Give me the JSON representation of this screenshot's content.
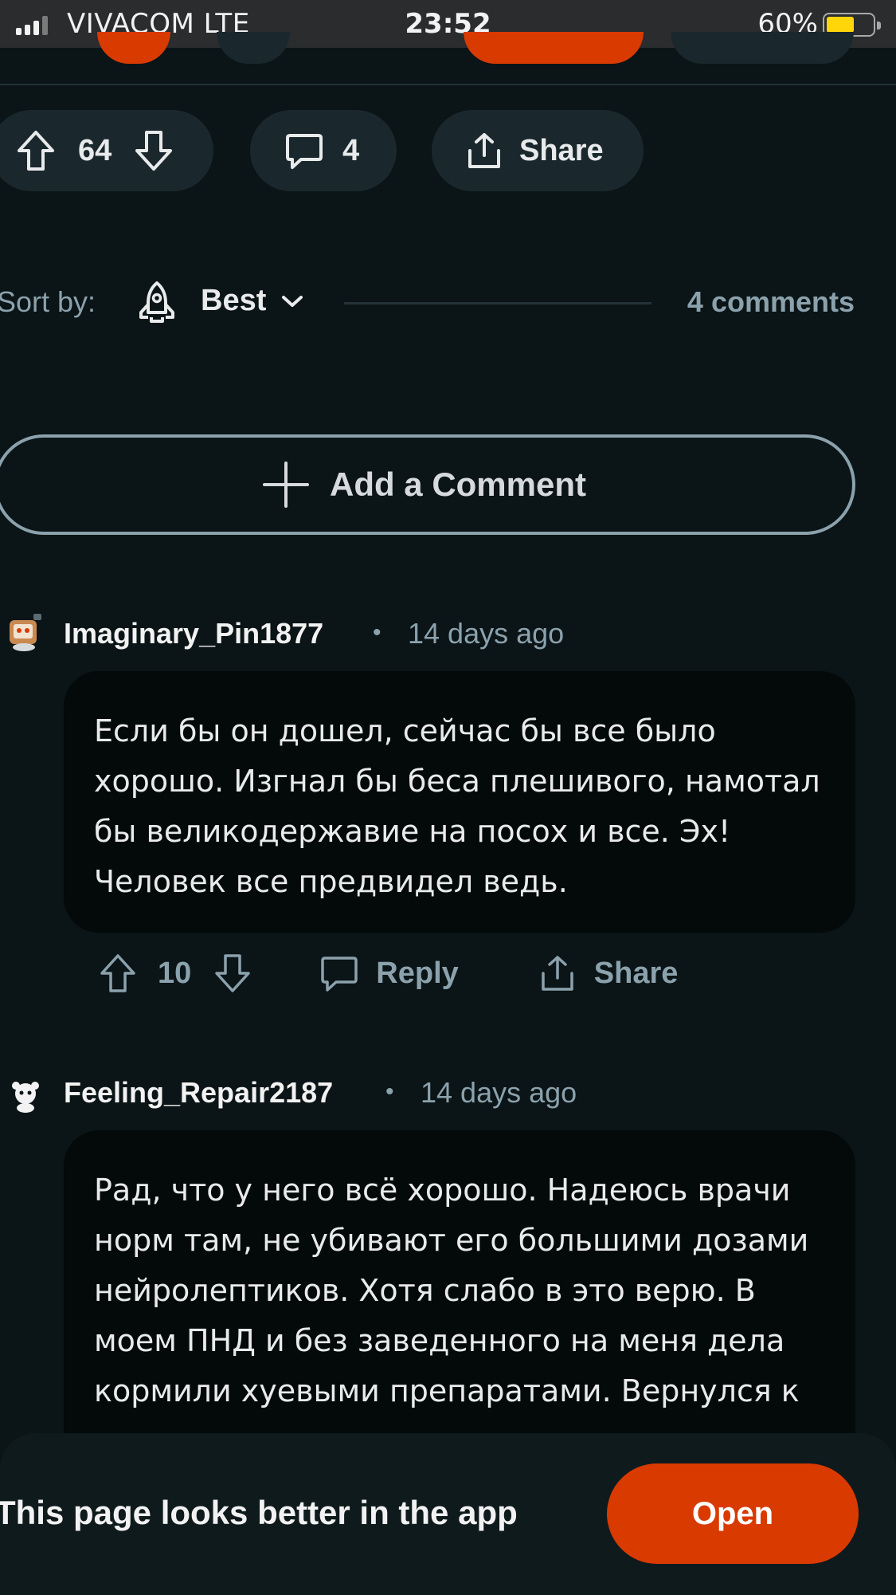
{
  "status_bar": {
    "carrier": "VIVACOM  LTE",
    "time": "23:52",
    "battery_percent": "60%",
    "battery_level": 0.6
  },
  "post_actions": {
    "vote_count": "64",
    "comment_count": "4",
    "share_label": "Share"
  },
  "sort": {
    "label": "Sort by:",
    "value": "Best",
    "total_comments": "4 comments"
  },
  "add_comment": {
    "label": "Add a Comment"
  },
  "comments": [
    {
      "author": "Imaginary_Pin1877",
      "separator": "•",
      "age": "14 days ago",
      "body": "Если бы он дошел, сейчас бы все было хорошо. Изгнал бы беса плешивого, намотал бы великодержавие на посох и все. Эх! Человек все предвидел ведь.",
      "votes": "10",
      "reply_label": "Reply",
      "share_label": "Share"
    },
    {
      "author": "Feeling_Repair2187",
      "separator": "•",
      "age": "14 days ago",
      "body": "Рад, что у него всё хорошо. Надеюсь врачи норм там, не убивают его большими дозами нейролептиков. Хотя слабо в это верю. В моем ПНД и без заведенного на меня дела кормили хуевыми препаратами. Вернулся к"
    }
  ],
  "banner": {
    "text": "This page looks better in the app",
    "button_label": "Open"
  },
  "colors": {
    "background": "#0b1416",
    "pill": "#1a282d",
    "accent": "#d93a00",
    "muted_text": "#8ba2ad"
  }
}
